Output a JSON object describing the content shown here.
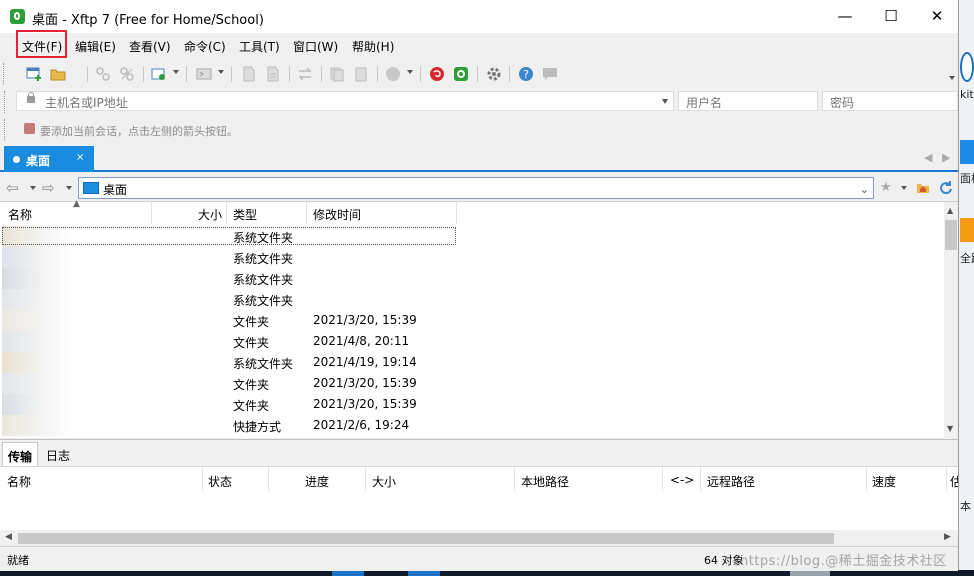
{
  "window": {
    "title": "桌面 - Xftp 7 (Free for Home/School)",
    "minimize": "—",
    "maximize": "☐",
    "close": "✕"
  },
  "menu": {
    "items": [
      "文件(F)",
      "编辑(E)",
      "查看(V)",
      "命令(C)",
      "工具(T)",
      "窗口(W)",
      "帮助(H)"
    ],
    "highlighted": "文件(F)",
    "badge": "1"
  },
  "connection": {
    "host_placeholder": "主机名或IP地址",
    "user_placeholder": "用户名",
    "password_placeholder": "密码"
  },
  "hint": {
    "text": "要添加当前会话，点击左侧的箭头按钮。"
  },
  "tabs": {
    "active_label": "桌面",
    "close": "×"
  },
  "path": {
    "current": "桌面"
  },
  "files": {
    "columns": [
      "名称",
      "大小",
      "类型",
      "修改时间"
    ],
    "rows": [
      {
        "type": "系统文件夹",
        "modified": ""
      },
      {
        "type": "系统文件夹",
        "modified": ""
      },
      {
        "type": "系统文件夹",
        "modified": ""
      },
      {
        "type": "系统文件夹",
        "modified": ""
      },
      {
        "type": "文件夹",
        "modified": "2021/3/20, 15:39"
      },
      {
        "type": "文件夹",
        "modified": "2021/4/8, 20:11"
      },
      {
        "type": "系统文件夹",
        "modified": "2021/4/19, 19:14"
      },
      {
        "type": "文件夹",
        "modified": "2021/3/20, 15:39"
      },
      {
        "type": "文件夹",
        "modified": "2021/3/20, 15:39"
      },
      {
        "type": "快捷方式",
        "modified": "2021/2/6, 19:24"
      }
    ]
  },
  "bottom_tabs": {
    "transfer": "传输",
    "log": "日志"
  },
  "transfer": {
    "columns": [
      "名称",
      "状态",
      "进度",
      "大小",
      "本地路径",
      "<->",
      "远程路径",
      "速度",
      "估"
    ]
  },
  "status": {
    "left": "就绪",
    "right": "64 对象",
    "watermark": "https://blog.@稀土掘金技术社区"
  },
  "desktop": {
    "label_1": "kit",
    "label_2": "面板",
    "label_3": "全跑",
    "label_4": "本"
  },
  "colors": {
    "accent": "#1a8ce0",
    "highlight_red": "#e0262f"
  }
}
